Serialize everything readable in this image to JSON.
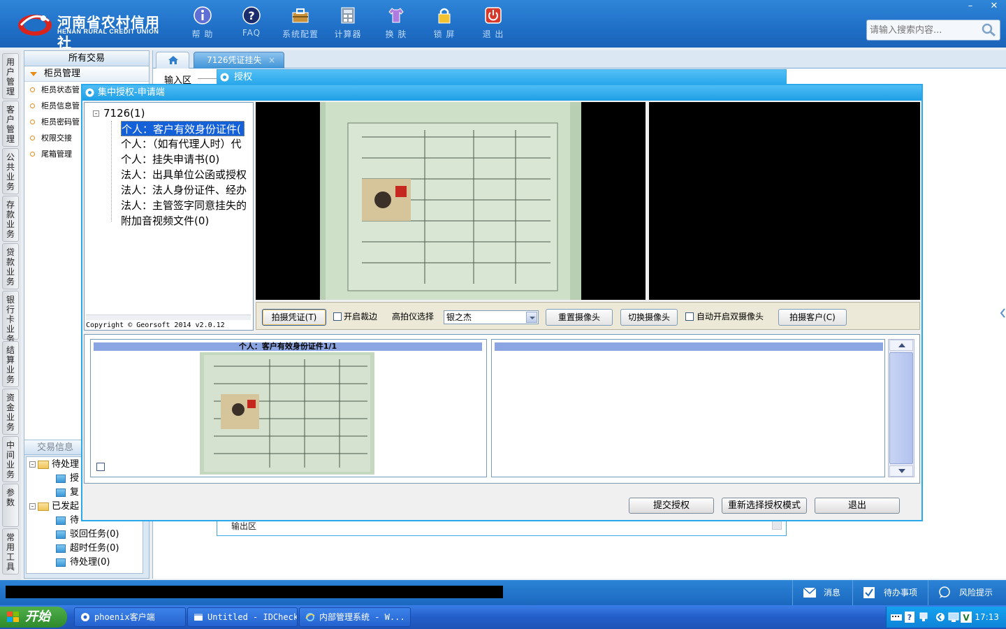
{
  "header": {
    "logo_cn": "河南省农村信用社",
    "logo_en": "HENAN RURAL CREDIT UNION",
    "toolbar": [
      {
        "label": "帮 助",
        "icon": "info-icon"
      },
      {
        "label": "FAQ",
        "icon": "question-icon"
      },
      {
        "label": "系统配置",
        "icon": "toolbox-icon"
      },
      {
        "label": "计算器",
        "icon": "calculator-icon"
      },
      {
        "label": "换 肤",
        "icon": "shirt-icon"
      },
      {
        "label": "锁 屏",
        "icon": "lock-icon"
      },
      {
        "label": "退 出",
        "icon": "power-icon"
      }
    ],
    "search_placeholder": "请输入搜索内容..."
  },
  "vtabs": [
    "用户管理",
    "客户管理",
    "公共业务",
    "存款业务",
    "贷款业务",
    "银行卡业务",
    "结算业务",
    "资金业务",
    "中间业务",
    "参数",
    "常用工具"
  ],
  "sidebar": {
    "title": "所有交易",
    "group": "柜员管理",
    "items": [
      "柜员状态管",
      "柜员信息管",
      "柜员密码管",
      "权限交接",
      "尾箱管理"
    ],
    "info_title": "交易信息",
    "tree": {
      "pending": "待处理",
      "pending_children": [
        "授",
        "复"
      ],
      "initiated": "已发起",
      "initiated_children": [
        "待",
        "驳回任务(0)",
        "超时任务(0)",
        "待处理(0)"
      ]
    }
  },
  "main": {
    "tab_active": "7126凭证挂失",
    "input_area": "输入区"
  },
  "auth_panel": {
    "title": "授权",
    "output_area": "输出区"
  },
  "modal": {
    "title": "集中授权-申请端",
    "tree_root": "7126(1)",
    "tree_items": [
      "个人：客户有效身份证件(",
      "个人：（如有代理人时）代",
      "个人：挂失申请书(0)",
      "法人：出具单位公函或授权",
      "法人：法人身份证件、经办",
      "法人：主管签字同意挂失的",
      "附加音视频文件(0)"
    ],
    "copyright": "Copyright © Georsoft 2014 v2.0.12",
    "controls": {
      "capture_voucher": "拍摄凭证(T)",
      "auto_crop": "开启裁边",
      "scanner_label": "高拍仪选择",
      "scanner_value": "银之杰",
      "reset_camera": "重置摄像头",
      "switch_camera": "切换摄像头",
      "dual_camera": "自动开启双摄像头",
      "capture_customer": "拍摄客户(C)"
    },
    "thumb_title": "个人：客户有效身份证件1/1",
    "buttons": {
      "submit": "提交授权",
      "reselect": "重新选择授权模式",
      "exit": "退出"
    }
  },
  "statusbar": {
    "messages": "消息",
    "todo": "待办事项",
    "risk": "风险提示"
  },
  "taskbar": {
    "start": "开始",
    "tasks": [
      "phoenix客户端",
      "Untitled - IDCheck",
      "内部管理系统 - W..."
    ],
    "clock": "17:13"
  }
}
